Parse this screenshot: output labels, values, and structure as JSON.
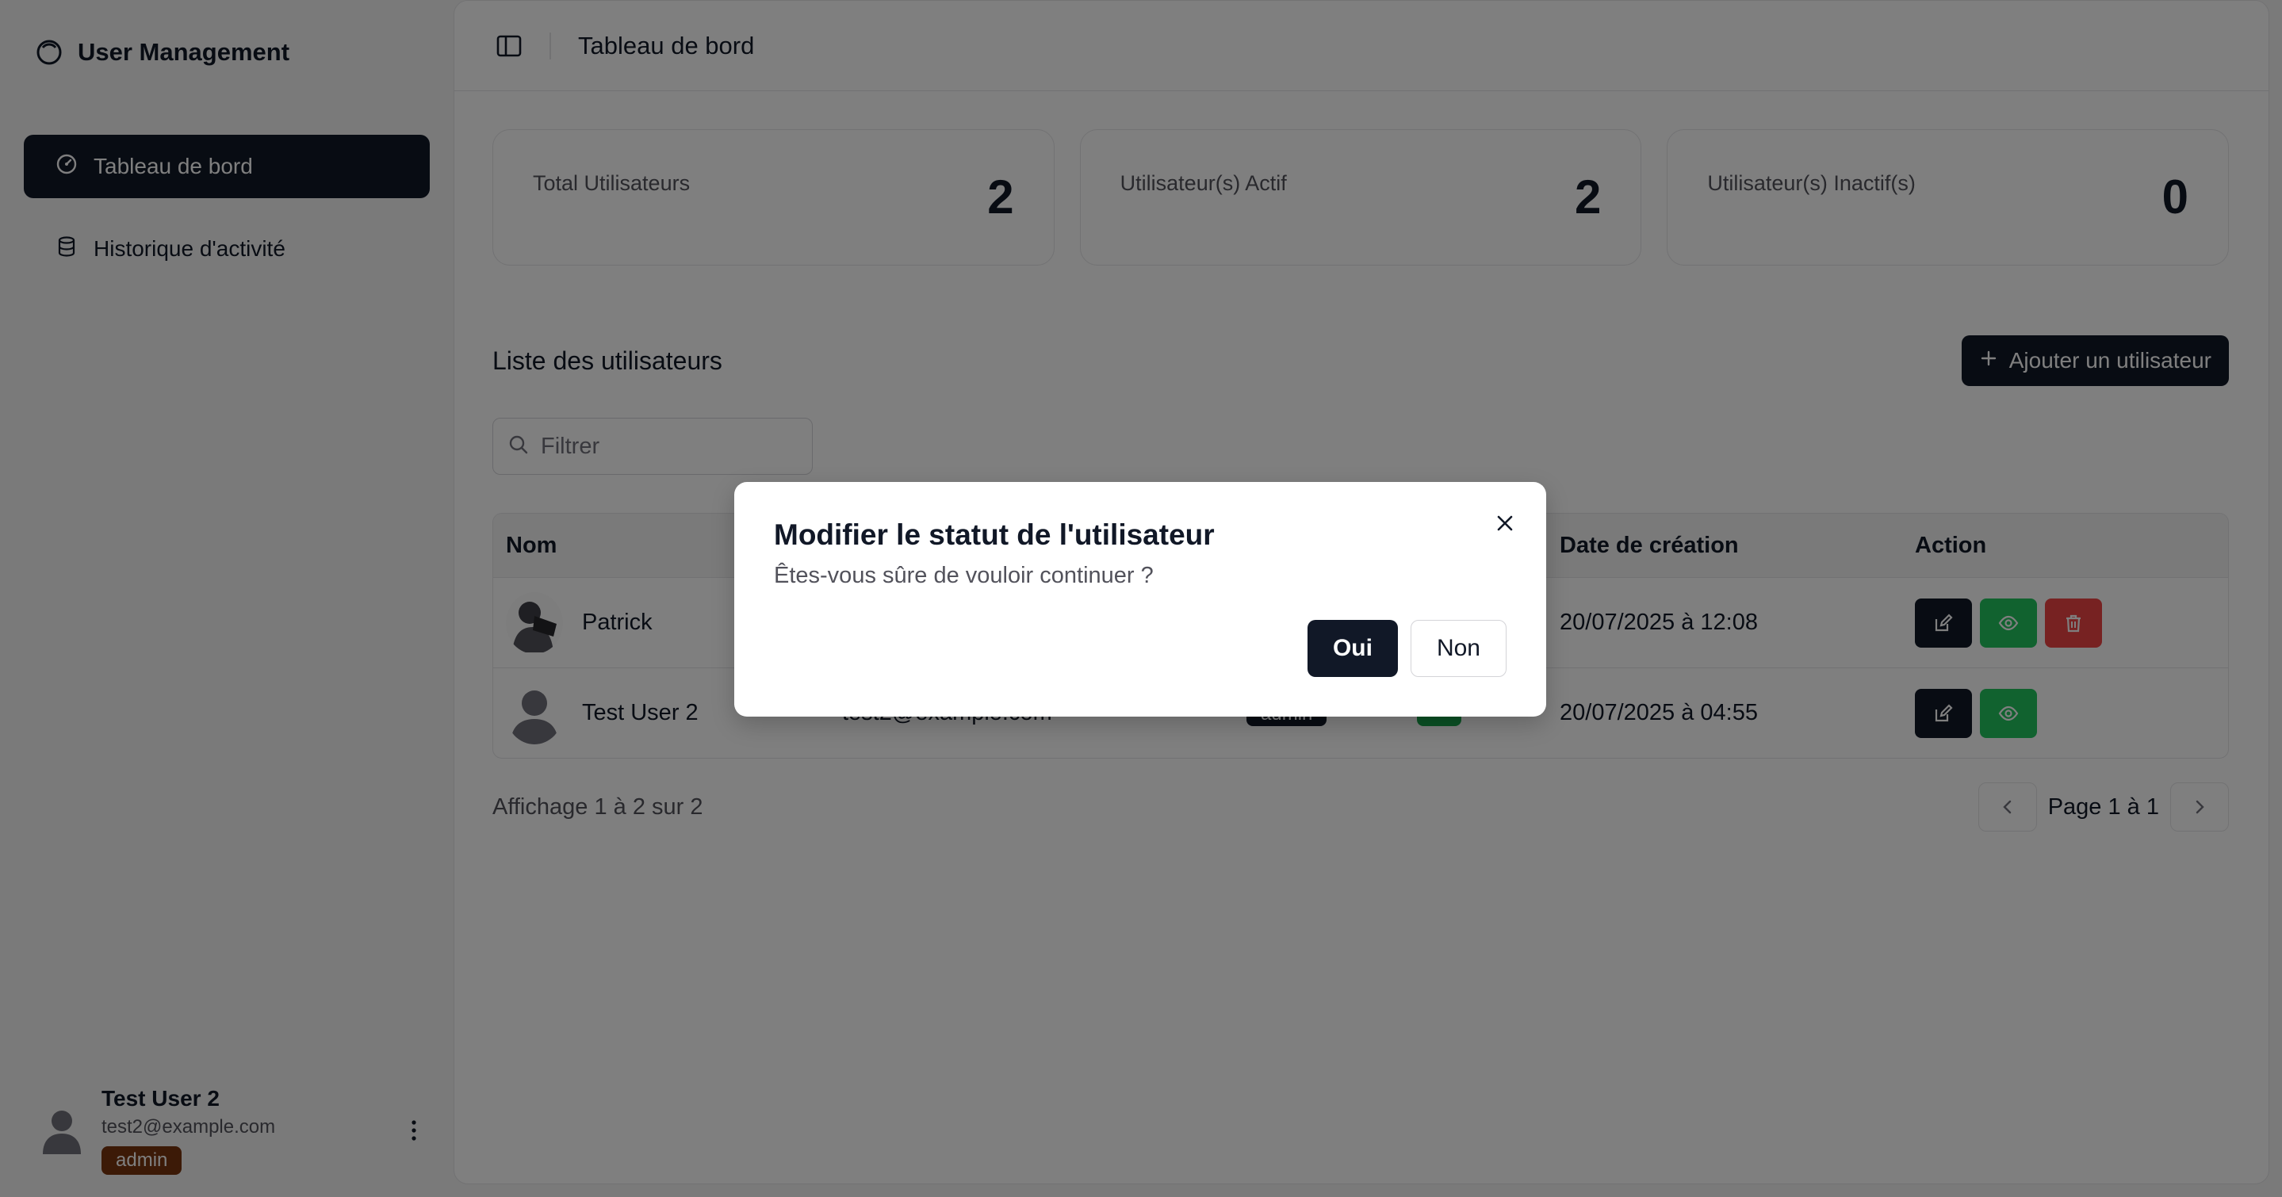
{
  "app": {
    "title": "User Management"
  },
  "sidebar": {
    "items": [
      {
        "label": "Tableau de bord",
        "icon": "gauge-icon",
        "active": true
      },
      {
        "label": "Historique d'activité",
        "icon": "database-icon",
        "active": false
      }
    ],
    "user": {
      "name": "Test User 2",
      "email": "test2@example.com",
      "role": "admin"
    }
  },
  "header": {
    "breadcrumb": "Tableau de bord"
  },
  "stats": [
    {
      "label": "Total Utilisateurs",
      "value": "2"
    },
    {
      "label": "Utilisateur(s) Actif",
      "value": "2"
    },
    {
      "label": "Utilisateur(s) Inactif(s)",
      "value": "0"
    }
  ],
  "list": {
    "title": "Liste des utilisateurs",
    "add_label": "Ajouter un utilisateur",
    "filter_placeholder": "Filtrer",
    "columns": {
      "name": "Nom",
      "date": "Date de création",
      "action": "Action"
    },
    "rows": [
      {
        "name": "Patrick",
        "date": "20/07/2025 à 12:08"
      },
      {
        "name": "Test User 2",
        "email": "test2@example.com",
        "role": "admin",
        "date": "20/07/2025 à 04:55"
      }
    ],
    "footer_info": "Affichage 1 à 2 sur 2",
    "page_label": "Page 1 à 1"
  },
  "modal": {
    "title": "Modifier le statut de l'utilisateur",
    "description": "Êtes-vous sûre de vouloir continuer ?",
    "confirm_label": "Oui",
    "cancel_label": "Non"
  },
  "colors": {
    "primary": "#111827",
    "success": "#22c55e",
    "danger": "#ef4444",
    "role_badge": "#78350f"
  }
}
